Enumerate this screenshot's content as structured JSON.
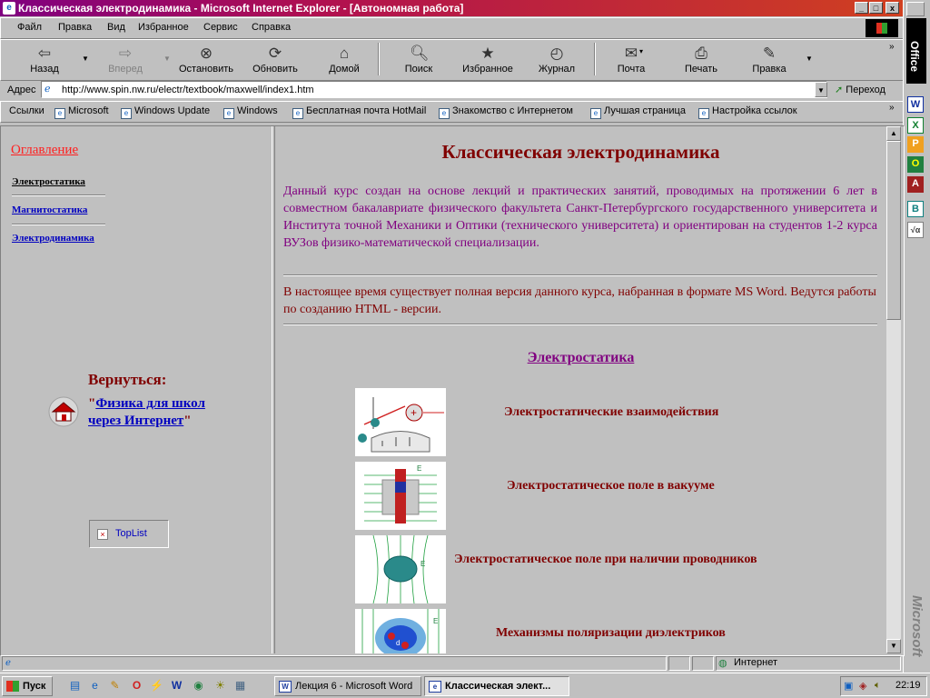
{
  "window": {
    "title": "Классическая электродинамика - Microsoft Internet Explorer - [Автономная работа]",
    "minimize": "_",
    "maximize": "□",
    "close": "x"
  },
  "menu": [
    "Файл",
    "Правка",
    "Вид",
    "Избранное",
    "Сервис",
    "Справка"
  ],
  "toolbar": {
    "back": "Назад",
    "forward": "Вперед",
    "stop": "Остановить",
    "refresh": "Обновить",
    "home": "Домой",
    "search": "Поиск",
    "favorites": "Избранное",
    "history": "Журнал",
    "mail": "Почта",
    "print": "Печать",
    "edit": "Правка"
  },
  "address": {
    "label": "Адрес",
    "url": "http://www.spin.nw.ru/electr/textbook/maxwell/index1.htm",
    "go": "Переход"
  },
  "links": {
    "label": "Ссылки",
    "items": [
      "Microsoft",
      "Windows Update",
      "Windows",
      "Бесплатная почта HotMail",
      "Знакомство с Интернетом",
      "Лучшая страница",
      "Настройка ссылок"
    ]
  },
  "office": {
    "label": "Office",
    "brand": "Microsoft"
  },
  "left": {
    "toc_title": "Оглавление",
    "toc": [
      "Электростатика",
      "Магнитостатика ",
      "Электродинамика"
    ],
    "return_title": "Вернуться:",
    "return_quote_open": "\"",
    "return_link": "Физика для школ через Интернет",
    "return_quote_close": "\"",
    "toplist": "TopList"
  },
  "main": {
    "title": "Классическая электродинамика",
    "intro": "Данный курс создан на основе лекций и практических занятий, проводимых на протяжении 6 лет в совместном бакалавриате физического факультета Санкт-Петербургского государственного университета и Института точной Механики и Оптики (технического университета) и ориентирован на студентов 1-2 курса ВУЗов физико-математической специализации.",
    "status": "В настоящее время существует полная версия данного курса, набранная в формате MS Word. Ведутся работы по созданию HTML - версии.",
    "section": "Электростатика",
    "topics": [
      "Электростатические взаимодействия",
      "Электростатическое поле в вакууме",
      "Электростатическое поле при наличии проводников",
      "Механизмы поляризации диэлектриков"
    ]
  },
  "statusbar": {
    "zone": "Интернет"
  },
  "taskbar": {
    "start": "Пуск",
    "tasks": [
      "Лекция 6 - Microsoft Word",
      "Классическая элект..."
    ],
    "clock": "22:19"
  }
}
